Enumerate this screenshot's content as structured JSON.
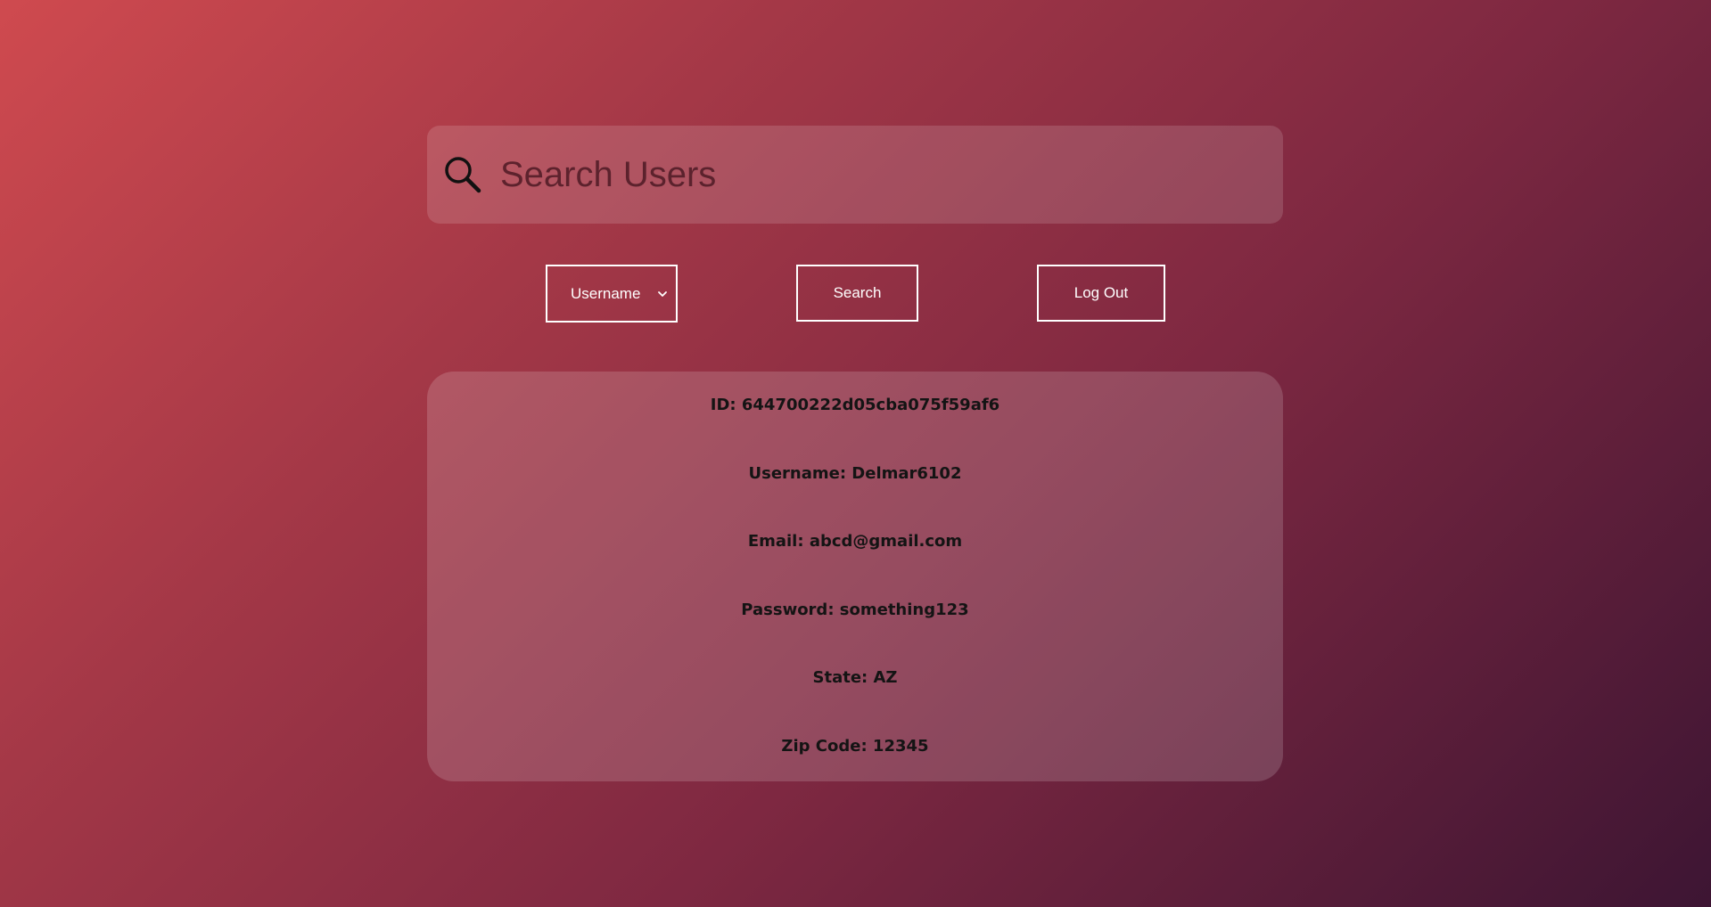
{
  "search": {
    "placeholder": "Search Users",
    "icon": "search-icon"
  },
  "controls": {
    "filter_select": {
      "selected": "Username",
      "icon": "chevron-down-icon"
    },
    "search_label": "Search",
    "logout_label": "Log Out"
  },
  "user": {
    "id": "ID: 644700222d05cba075f59af6",
    "username": "Username: Delmar6102",
    "email": "Email: abcd@gmail.com",
    "password": "Password: something123",
    "state": "State: AZ",
    "zip": "Zip Code: 12345"
  },
  "colors": {
    "gradient_start": "#cf4a4f",
    "gradient_end": "#3d1533",
    "control_border": "#ffffff"
  }
}
